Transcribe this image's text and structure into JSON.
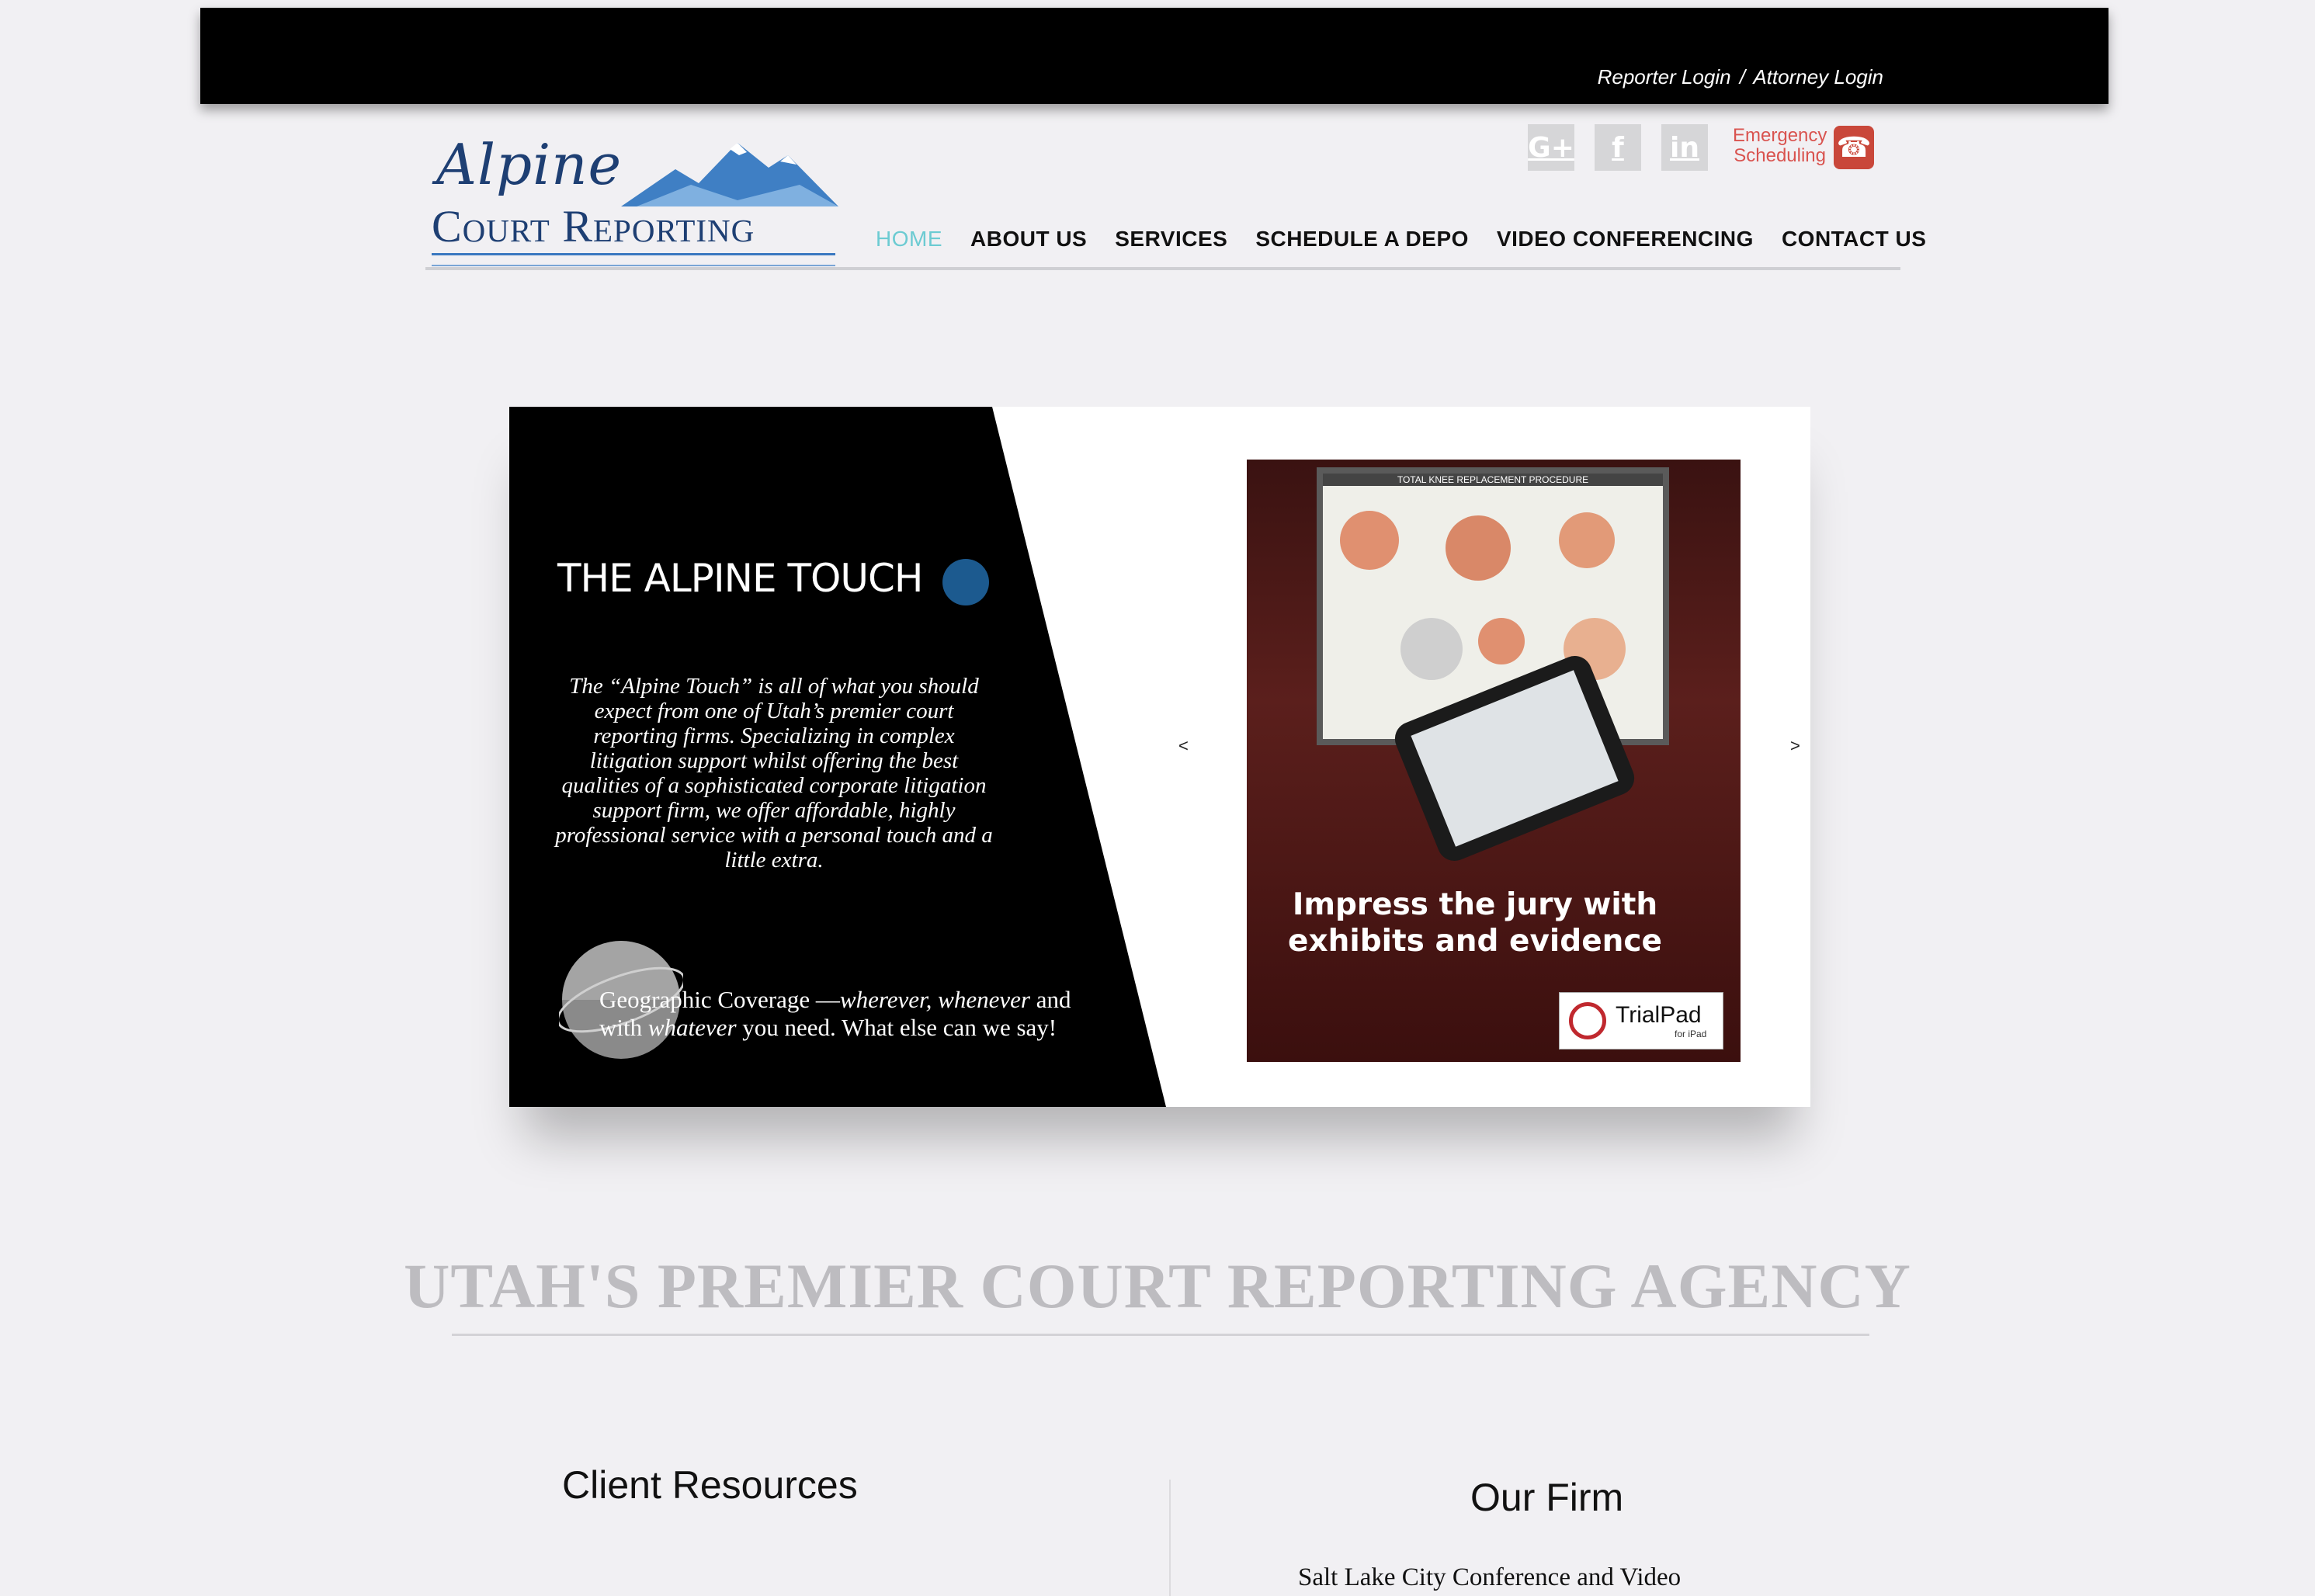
{
  "header": {
    "reporter_login": "Reporter Login",
    "separator": "/",
    "attorney_login": "Attorney Login"
  },
  "logo": {
    "script_text": "Alpine",
    "court_text": "Court Reporting"
  },
  "social": {
    "google_icon": "G+",
    "facebook_icon": "f",
    "linkedin_icon": "in"
  },
  "emergency": {
    "line1": "Emergency",
    "line2": "Scheduling"
  },
  "nav": {
    "items": [
      "HOME",
      "ABOUT US",
      "SERVICES",
      "SCHEDULE A DEPO",
      "VIDEO CONFERENCING",
      "CONTACT US"
    ],
    "active": "HOME"
  },
  "slider": {
    "title": "THE ALPINE TOUCH",
    "body": "The “Alpine Touch” is all of what you should expect from one of Utah’s premier court reporting firms. Specializing in complex litigation support whilst offering the best qualities of a sophisticated corporate litigation support firm, we offer affordable, highly professional service with a personal touch and a little extra.",
    "geo_part1": "Geographic Coverage —",
    "geo_italic1": "wherever, whenever",
    "geo_part2": " and with ",
    "geo_italic2": "whatever",
    "geo_part3": " you need. What else can we say!",
    "prev_arrow": "<",
    "next_arrow": ">",
    "photo_caption_line1": "Impress the jury with",
    "photo_caption_line2": "exhibits and evidence",
    "board_title": "TOTAL KNEE REPLACEMENT PROCEDURE",
    "brand_name": "TrialPad",
    "brand_sub": "for iPad"
  },
  "headline": "UTAH'S PREMIER COURT REPORTING AGENCY",
  "columns": {
    "client_resources": "Client Resources",
    "our_firm": "Our Firm",
    "our_firm_text": "Salt Lake City Conference and Video"
  },
  "colors": {
    "nav_active": "#6ccbd2",
    "logo_blue": "#1e3f73",
    "emergency_red": "#d9534f",
    "slide_dot": "#1c5a8f"
  }
}
